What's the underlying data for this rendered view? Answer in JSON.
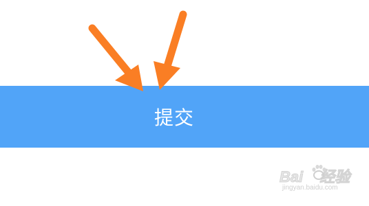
{
  "submit": {
    "label": "提交"
  },
  "watermark": {
    "brand_left": "Bai",
    "brand_right": "经验",
    "domain": "jingyan.baidu.com"
  },
  "colors": {
    "button_bg": "#51a4f8",
    "button_text": "#ffffff",
    "arrow": "#fa7e24"
  },
  "icons": [
    "arrow-pointer-icon",
    "baidu-paw-icon"
  ]
}
